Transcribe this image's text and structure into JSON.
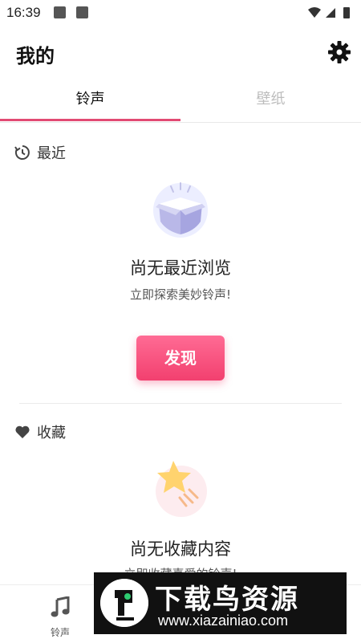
{
  "status_bar": {
    "time": "16:39"
  },
  "header": {
    "title": "我的"
  },
  "tabs": [
    {
      "label": "铃声"
    },
    {
      "label": "壁纸"
    }
  ],
  "recent": {
    "heading": "最近",
    "empty_title": "尚无最近浏览",
    "empty_subtitle": "立即探索美妙铃声!",
    "button_label": "发现"
  },
  "favorites": {
    "heading": "收藏",
    "empty_title": "尚无收藏内容",
    "empty_subtitle": "立即收藏喜爱的铃声!"
  },
  "bottom_nav": {
    "items": [
      {
        "label": "铃声",
        "icon": "music-note-icon"
      }
    ]
  },
  "watermark": {
    "title": "下载鸟资源",
    "url": "www.xiazainiao.com"
  },
  "colors": {
    "accent": "#e24a73",
    "button_gradient_top": "#ff6b94",
    "button_gradient_bottom": "#f2406f"
  }
}
